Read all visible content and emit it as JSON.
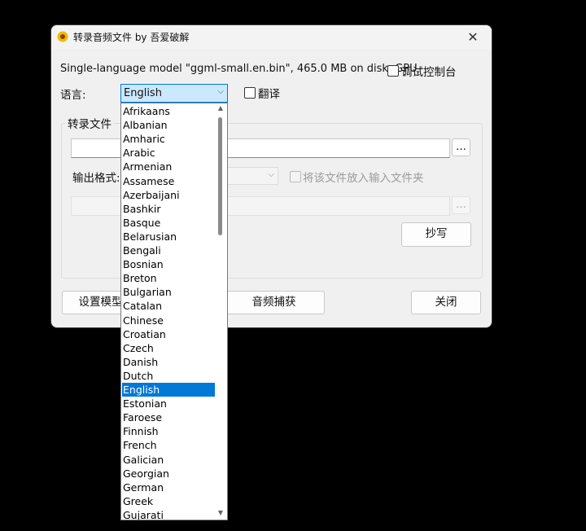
{
  "window": {
    "title": "转录音频文件 by 吾爱破解",
    "close_glyph": "✕"
  },
  "model_info": "Single-language model \"ggml-small.en.bin\", 465.0 MB on disk, GPU",
  "debug_console_label": "调试控制台",
  "language": {
    "label": "语言:",
    "selected": "English",
    "translate_label": "翻译",
    "options": [
      "Afrikaans",
      "Albanian",
      "Amharic",
      "Arabic",
      "Armenian",
      "Assamese",
      "Azerbaijani",
      "Bashkir",
      "Basque",
      "Belarusian",
      "Bengali",
      "Bosnian",
      "Breton",
      "Bulgarian",
      "Catalan",
      "Chinese",
      "Croatian",
      "Czech",
      "Danish",
      "Dutch",
      "English",
      "Estonian",
      "Faroese",
      "Finnish",
      "French",
      "Galician",
      "Georgian",
      "German",
      "Greek",
      "Gujarati"
    ]
  },
  "transcribe_group": {
    "title": "转录文件",
    "input_browse": "...",
    "output_format_label": "输出格式:",
    "place_in_input_folder_label": "将该文件放入输入文件夹",
    "output_browse": "...",
    "transcribe_button": "抄写"
  },
  "footer": {
    "setup_model_button": "设置模型",
    "audio_capture_button": "音频捕获",
    "close_button": "关闭"
  },
  "icons": {
    "app": "sunflower-icon",
    "dropdown_arrow": "chevron-down-icon"
  },
  "colors": {
    "selection": "#0078d7",
    "combo_focus_bg": "#cce8ff"
  }
}
